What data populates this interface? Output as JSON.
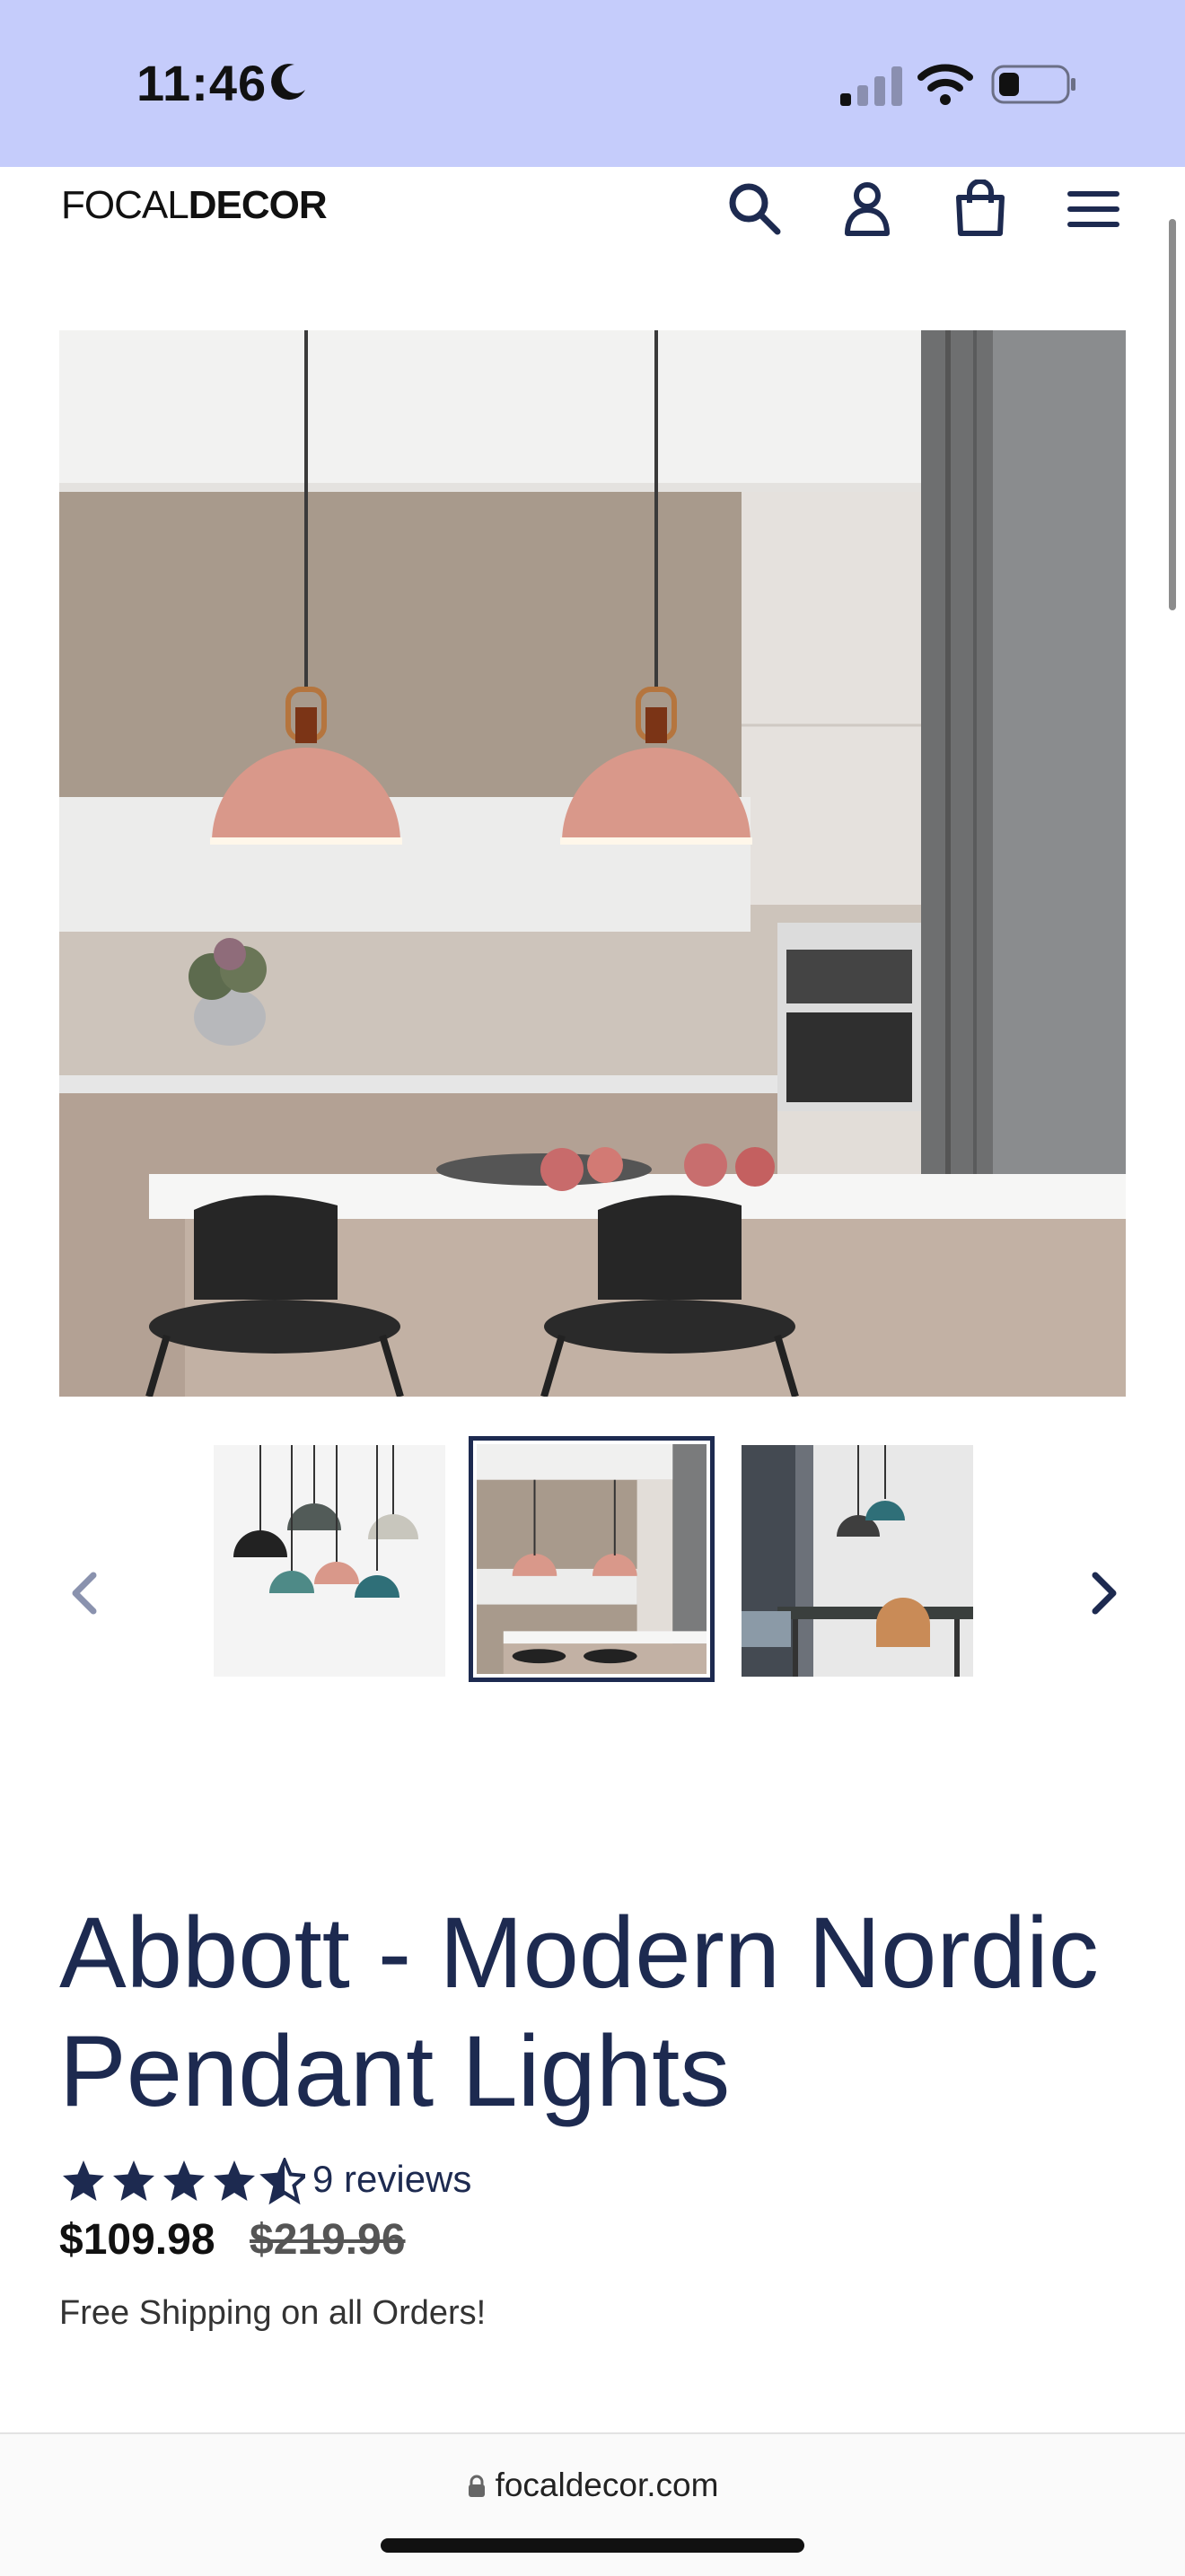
{
  "status_bar": {
    "time": "11:46",
    "background": "#c5ccfb"
  },
  "header": {
    "logo_light": "FOCAL",
    "logo_bold": "DECOR",
    "icons": [
      "search-icon",
      "account-icon",
      "cart-icon",
      "menu-icon"
    ]
  },
  "product": {
    "title": "Abbott - Modern Nordic Pendant Lights",
    "rating": 4.5,
    "reviews_label": "9 reviews",
    "price": "$109.98",
    "compare_price": "$219.96",
    "shipping_note": "Free Shipping on all Orders!",
    "thumbnails_selected_index": 1,
    "thumbnails_count": 3
  },
  "browser": {
    "url": "focaldecor.com"
  },
  "colors": {
    "brand_navy": "#1d2a50",
    "shade_pink": "#d9988a",
    "wall_taupe": "#a89a8c"
  }
}
